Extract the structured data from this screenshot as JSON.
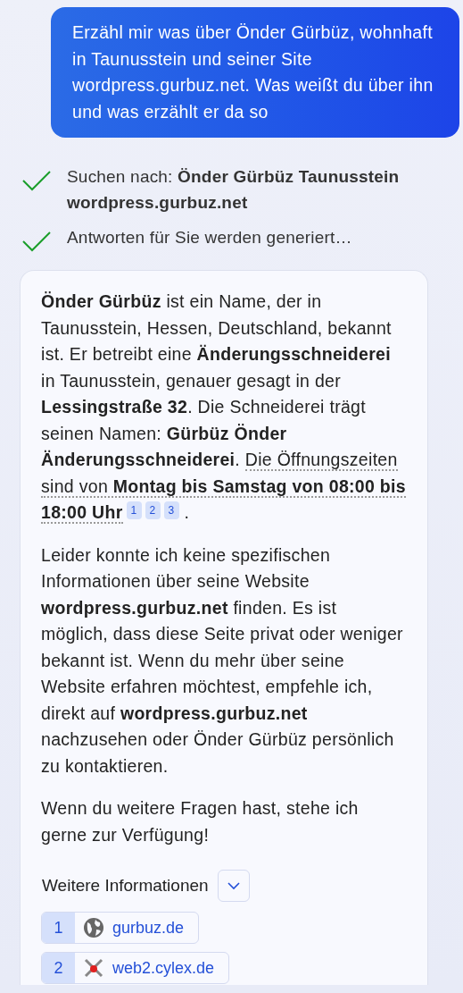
{
  "user_message": "Erzähl mir was über Önder Gürbüz, wohnhaft in Taunusstein und seiner Site wordpress.gurbuz.net. Was weißt du über ihn und was erzählt er da so",
  "steps": [
    {
      "text": "Suchen nach: **Önder Gürbüz Taunusstein wordpress.gurbuz.net**",
      "done": true
    },
    {
      "text": "Antworten für Sie werden generiert…",
      "done": true
    }
  ],
  "answer": {
    "paragraphs": [
      {
        "segments": [
          {
            "kind": "plain",
            "text": "**Önder Gürbüz** ist ein Name, der in Taunusstein, Hessen, Deutschland, bekannt ist. Er betreibt eine **Änderungsschneiderei** in Taunusstein, genauer gesagt in der **Lessingstraße 32**. Die Schneiderei trägt seinen Namen: **Gürbüz Önder Änderungsschneiderei**. "
          },
          {
            "kind": "cited",
            "text": "Die Öffnungszeiten sind von **Montag bis Samstag von 08:00 bis 18:00 Uhr**"
          }
        ],
        "citations": [
          "1",
          "2",
          "3"
        ],
        "end": "."
      },
      {
        "segments": [
          {
            "kind": "plain",
            "text": "Leider konnte ich keine spezifischen Informationen über seine Website **wordpress.gurbuz.net** finden. Es ist möglich, dass diese Seite privat oder weniger bekannt ist. Wenn du mehr über seine Website erfahren möchtest, empfehle ich, direkt auf **wordpress.gurbuz.net** nachzusehen oder Önder Gürbüz persönlich zu kontaktieren."
          }
        ]
      },
      {
        "segments": [
          {
            "kind": "plain",
            "text": "Wenn du weitere Fragen hast, stehe ich gerne zur Verfügung!"
          }
        ]
      }
    ],
    "more_info": {
      "label": "Weitere Informationen",
      "expanded": false
    },
    "sources": [
      {
        "number": "1",
        "site": "gurbuz.de"
      },
      {
        "number": "2",
        "site": "web2.cylex.de"
      }
    ]
  }
}
